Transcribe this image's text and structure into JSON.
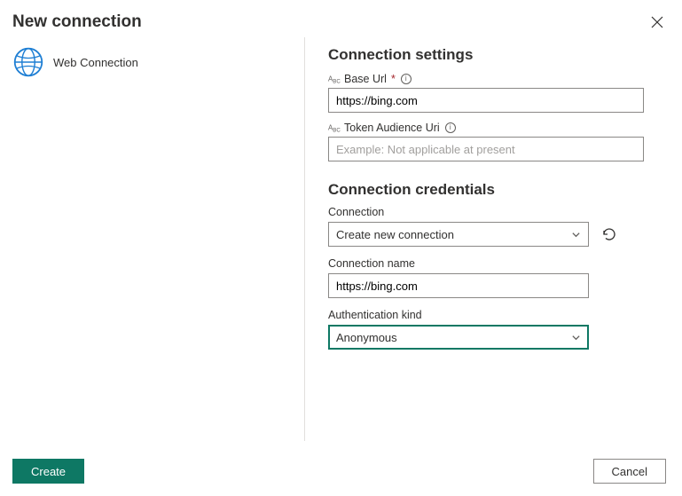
{
  "header": {
    "title": "New connection"
  },
  "left": {
    "connection_type_label": "Web Connection"
  },
  "settings": {
    "heading": "Connection settings",
    "base_url_label": "Base Url",
    "base_url_value": "https://bing.com",
    "token_audience_label": "Token Audience Uri",
    "token_audience_placeholder": "Example: Not applicable at present"
  },
  "credentials": {
    "heading": "Connection credentials",
    "connection_label": "Connection",
    "connection_value": "Create new connection",
    "connection_name_label": "Connection name",
    "connection_name_value": "https://bing.com",
    "auth_kind_label": "Authentication kind",
    "auth_kind_value": "Anonymous"
  },
  "footer": {
    "create_label": "Create",
    "cancel_label": "Cancel"
  }
}
